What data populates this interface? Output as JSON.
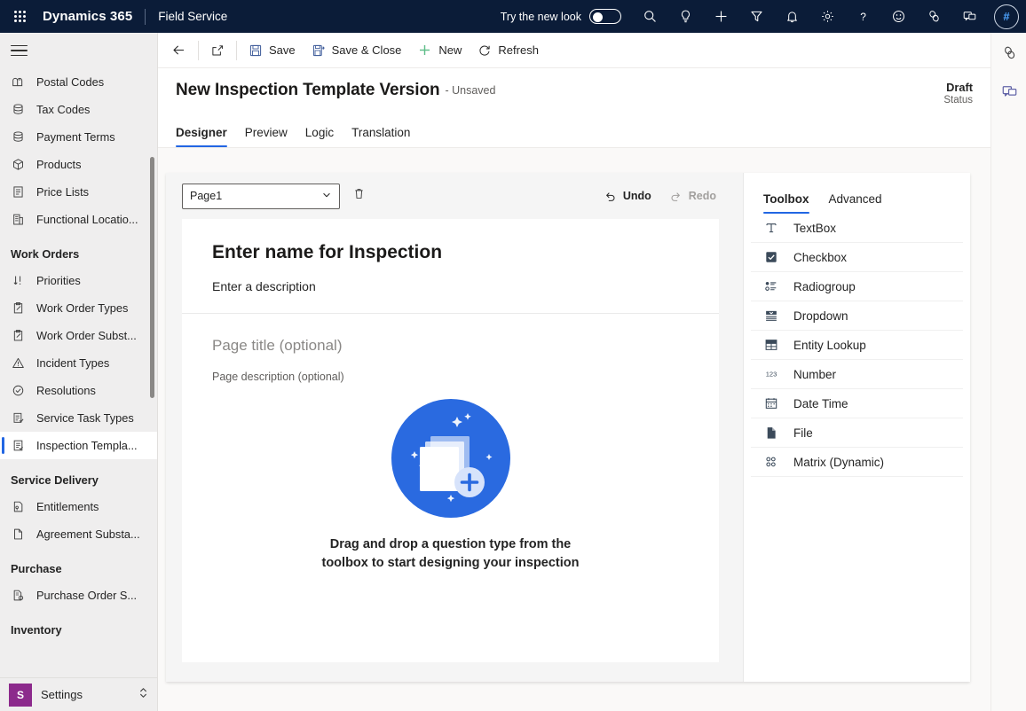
{
  "topbar": {
    "waffle": "app-launcher",
    "brand": "Dynamics 365",
    "app_name": "Field Service",
    "new_look_label": "Try the new look",
    "new_look_state": "off",
    "icons": [
      "search-icon",
      "lightbulb-icon",
      "plus-icon",
      "filter-icon",
      "bell-icon",
      "gear-icon",
      "question-icon",
      "smiley-icon",
      "accessibility-icon",
      "feedback-icon"
    ],
    "avatar_text": "#"
  },
  "sidebar": {
    "items": [
      {
        "label": "Postal Codes",
        "icon": "mailbox-icon",
        "selected": false
      },
      {
        "label": "Tax Codes",
        "icon": "stack-icon",
        "selected": false
      },
      {
        "label": "Payment Terms",
        "icon": "stack-icon",
        "selected": false
      },
      {
        "label": "Products",
        "icon": "box-icon",
        "selected": false
      },
      {
        "label": "Price Lists",
        "icon": "document-icon",
        "selected": false
      },
      {
        "label": "Functional Locatio...",
        "icon": "building-icon",
        "selected": false
      }
    ],
    "group_work_orders": "Work Orders",
    "work_order_items": [
      {
        "label": "Priorities",
        "icon": "sort-icon",
        "selected": false
      },
      {
        "label": "Work Order Types",
        "icon": "clipboard-icon",
        "selected": false
      },
      {
        "label": "Work Order Subst...",
        "icon": "clipboard-icon",
        "selected": false
      },
      {
        "label": "Incident Types",
        "icon": "warning-icon",
        "selected": false
      },
      {
        "label": "Resolutions",
        "icon": "check-circle-icon",
        "selected": false
      },
      {
        "label": "Service Task Types",
        "icon": "tasks-icon",
        "selected": false
      },
      {
        "label": "Inspection Templa...",
        "icon": "inspection-icon",
        "selected": true
      }
    ],
    "group_service_delivery": "Service Delivery",
    "service_delivery_items": [
      {
        "label": "Entitlements",
        "icon": "entitlement-icon",
        "selected": false
      },
      {
        "label": "Agreement Substa...",
        "icon": "document-icon",
        "selected": false
      }
    ],
    "group_purchase": "Purchase",
    "purchase_items": [
      {
        "label": "Purchase Order S...",
        "icon": "purchase-icon",
        "selected": false
      }
    ],
    "group_inventory": "Inventory",
    "settings": {
      "badge": "S",
      "label": "Settings",
      "chevron": "up-down-chevron-icon"
    }
  },
  "commandbar": {
    "back": "back-arrow-icon",
    "popout": "open-in-new-window-icon",
    "save": "Save",
    "save_and_close": "Save & Close",
    "new": "New",
    "refresh": "Refresh"
  },
  "record": {
    "title": "New Inspection Template Version",
    "subtitle": "- Unsaved",
    "status_value": "Draft",
    "status_label": "Status"
  },
  "tabs": [
    {
      "label": "Designer",
      "active": true
    },
    {
      "label": "Preview",
      "active": false
    },
    {
      "label": "Logic",
      "active": false
    },
    {
      "label": "Translation",
      "active": false
    }
  ],
  "designer": {
    "page_select_value": "Page1",
    "delete_icon": "trash-icon",
    "undo": "Undo",
    "redo": "Redo",
    "undo_enabled": true,
    "redo_enabled": false,
    "inspection_name_placeholder": "Enter name for Inspection",
    "inspection_description_placeholder": "Enter a description",
    "page_title_placeholder": "Page title (optional)",
    "page_description_placeholder": "Page description (optional)",
    "empty_state_text": "Drag and drop a question type from the toolbox to start designing your inspection",
    "empty_state_illustration": "add-pages-illustration"
  },
  "toolbox": {
    "tabs": [
      {
        "label": "Toolbox",
        "active": true
      },
      {
        "label": "Advanced",
        "active": false
      }
    ],
    "items": [
      {
        "label": "TextBox",
        "icon": "text-icon"
      },
      {
        "label": "Checkbox",
        "icon": "checkbox-icon"
      },
      {
        "label": "Radiogroup",
        "icon": "radiogroup-icon"
      },
      {
        "label": "Dropdown",
        "icon": "dropdown-icon"
      },
      {
        "label": "Entity Lookup",
        "icon": "entity-lookup-icon"
      },
      {
        "label": "Number",
        "icon": "number-icon"
      },
      {
        "label": "Date Time",
        "icon": "calendar-icon"
      },
      {
        "label": "File",
        "icon": "file-icon"
      },
      {
        "label": "Matrix (Dynamic)",
        "icon": "matrix-icon"
      }
    ]
  },
  "rightrail": {
    "icons": [
      "copilot-icon",
      "teams-chat-icon"
    ]
  },
  "colors": {
    "header_bg": "#0b1c38",
    "accent": "#2266e3",
    "settings_badge": "#8c2a8c",
    "illustration_blue": "#2a6ae0",
    "new_plus_green": "#5fbe8a"
  }
}
